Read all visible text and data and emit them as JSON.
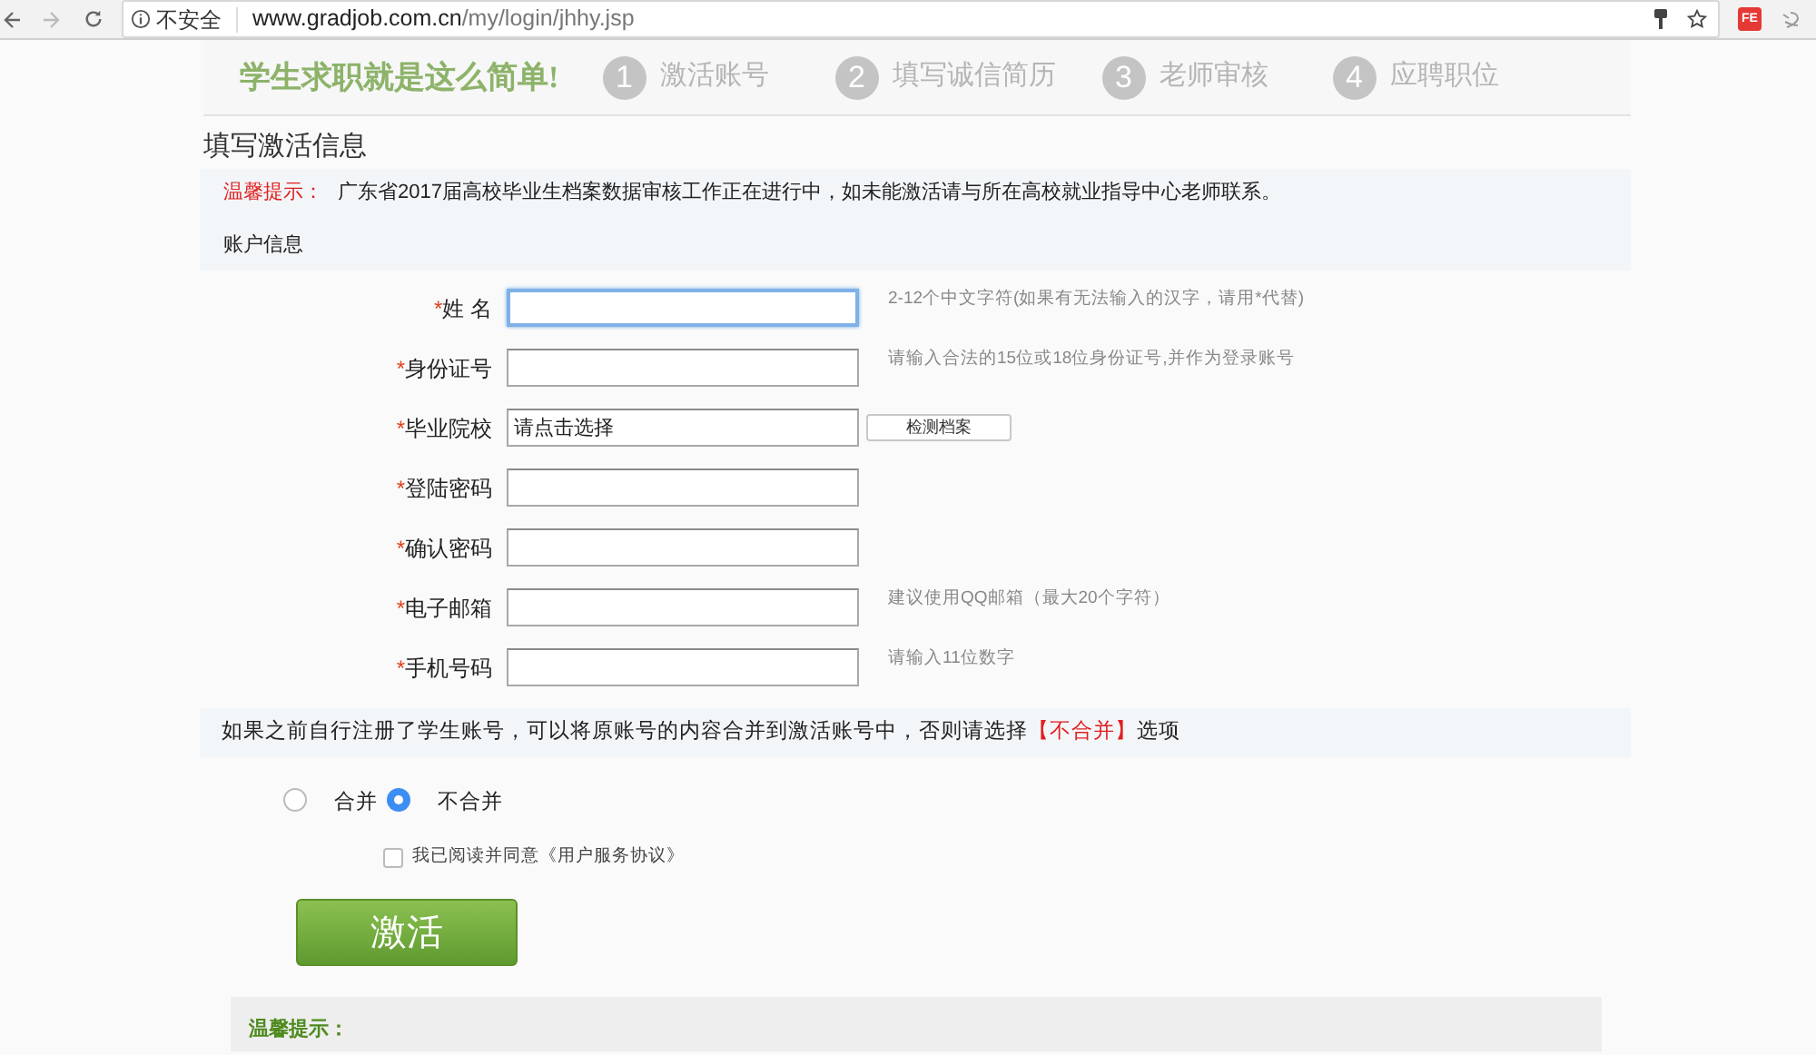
{
  "browser": {
    "security": "不安全",
    "url_host": "www.gradjob.com.cn",
    "url_path": "/my/login/jhhy.jsp",
    "extension_badge": "FE"
  },
  "steps_banner": {
    "slogan": "学生求职就是这么简单!",
    "steps": [
      {
        "number": "1",
        "label": "激活账号"
      },
      {
        "number": "2",
        "label": "填写诚信简历"
      },
      {
        "number": "3",
        "label": "老师审核"
      },
      {
        "number": "4",
        "label": "应聘职位"
      }
    ]
  },
  "page_title": "填写激活信息",
  "notice": {
    "label": "温馨提示：",
    "text": "广东省2017届高校毕业生档案数据审核工作正在进行中，如未能激活请与所在高校就业指导中心老师联系。"
  },
  "section_title": "账户信息",
  "fields": [
    {
      "label": "姓 名",
      "required_mark": "*",
      "focused": true,
      "hint": "2-12个中文字符(如果有无法输入的汉字，请用*代替)"
    },
    {
      "label": "身份证号",
      "required_mark": "*",
      "focused": false,
      "hint": "请输入合法的15位或18位身份证号,并作为登录账号"
    },
    {
      "label": "毕业院校",
      "required_mark": "*",
      "focused": false,
      "value": "请点击选择",
      "button": "检测档案"
    },
    {
      "label": "登陆密码",
      "required_mark": "*",
      "focused": false
    },
    {
      "label": "确认密码",
      "required_mark": "*",
      "focused": false
    },
    {
      "label": "电子邮箱",
      "required_mark": "*",
      "focused": false,
      "hint": "建议使用QQ邮箱（最大20个字符）"
    },
    {
      "label": "手机号码",
      "required_mark": "*",
      "focused": false,
      "hint": "请输入11位数字"
    }
  ],
  "merge_note": {
    "text_before": "如果之前自行注册了学生账号，可以将原账号的内容合并到激活账号中，否则请选择",
    "highlight": "【不合并】",
    "text_after": "选项"
  },
  "merge_options": [
    {
      "label": "合并",
      "selected": false
    },
    {
      "label": "不合并",
      "selected": true
    }
  ],
  "agreement": {
    "label": "我已阅读并同意《用户服务协议》",
    "checked": false
  },
  "submit_button": "激活",
  "bottom_notice": {
    "label": "温馨提示："
  }
}
